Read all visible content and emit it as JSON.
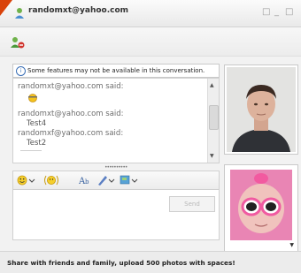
{
  "window": {
    "title": "randomxt@yahoo.com",
    "controls": [
      "□",
      "_",
      "□"
    ]
  },
  "toolbar": {
    "icon": "add-contact-icon"
  },
  "notice": {
    "icon": "info-icon",
    "text": "Some features may not be available in this conversation."
  },
  "conversation": {
    "entries": [
      {
        "sender": "randomxt@yahoo.com said:",
        "message": "",
        "emoji": "sun-emoticon"
      },
      {
        "sender": "randomxt@yahoo.com said:",
        "message": "Test4"
      },
      {
        "sender": "randomxf@yahoo.com said:",
        "message": "Test2"
      }
    ]
  },
  "format_bar": {
    "items": [
      "emoticon-menu",
      "audible-emoticon",
      "font",
      "pen-color",
      "extras-menu"
    ]
  },
  "compose": {
    "send_label": "Send"
  },
  "footer": {
    "text": "Share with friends and family, upload 500 photos with spaces!"
  },
  "colors": {
    "accent": "#d9420a",
    "link_blue": "#3a6fb6"
  }
}
